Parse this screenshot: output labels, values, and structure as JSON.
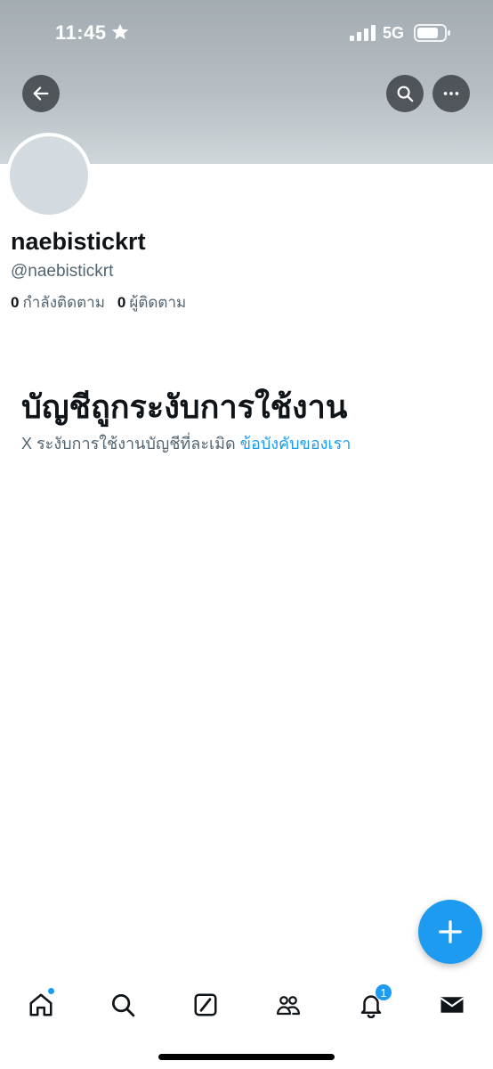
{
  "status_bar": {
    "time": "11:45",
    "network": "5G",
    "icons": [
      "star-icon",
      "signal-icon",
      "battery-icon"
    ]
  },
  "header": {
    "icons": [
      "arrow-left-icon",
      "search-icon",
      "more-icon"
    ]
  },
  "profile": {
    "display_name": "naebistickrt",
    "handle": "@naebistickrt",
    "following_count": "0",
    "following_label": "กำลังติดตาม",
    "followers_count": "0",
    "followers_label": "ผู้ติดตาม"
  },
  "notice": {
    "title": "บัญชีถูกระงับการใช้งาน",
    "text": "X ระงับการใช้งานบัญชีที่ละเมิด",
    "link": "ข้อบังคับของเรา"
  },
  "fab": {
    "icon": "plus-icon"
  },
  "bottom_nav": {
    "items": [
      "home-icon",
      "search-icon",
      "grok-icon",
      "communities-icon",
      "bell-icon",
      "envelope-icon"
    ],
    "notifications_badge": "1"
  },
  "colors": {
    "accent": "#1d9bf0",
    "text_primary": "#0f1419",
    "text_secondary": "#536471"
  }
}
